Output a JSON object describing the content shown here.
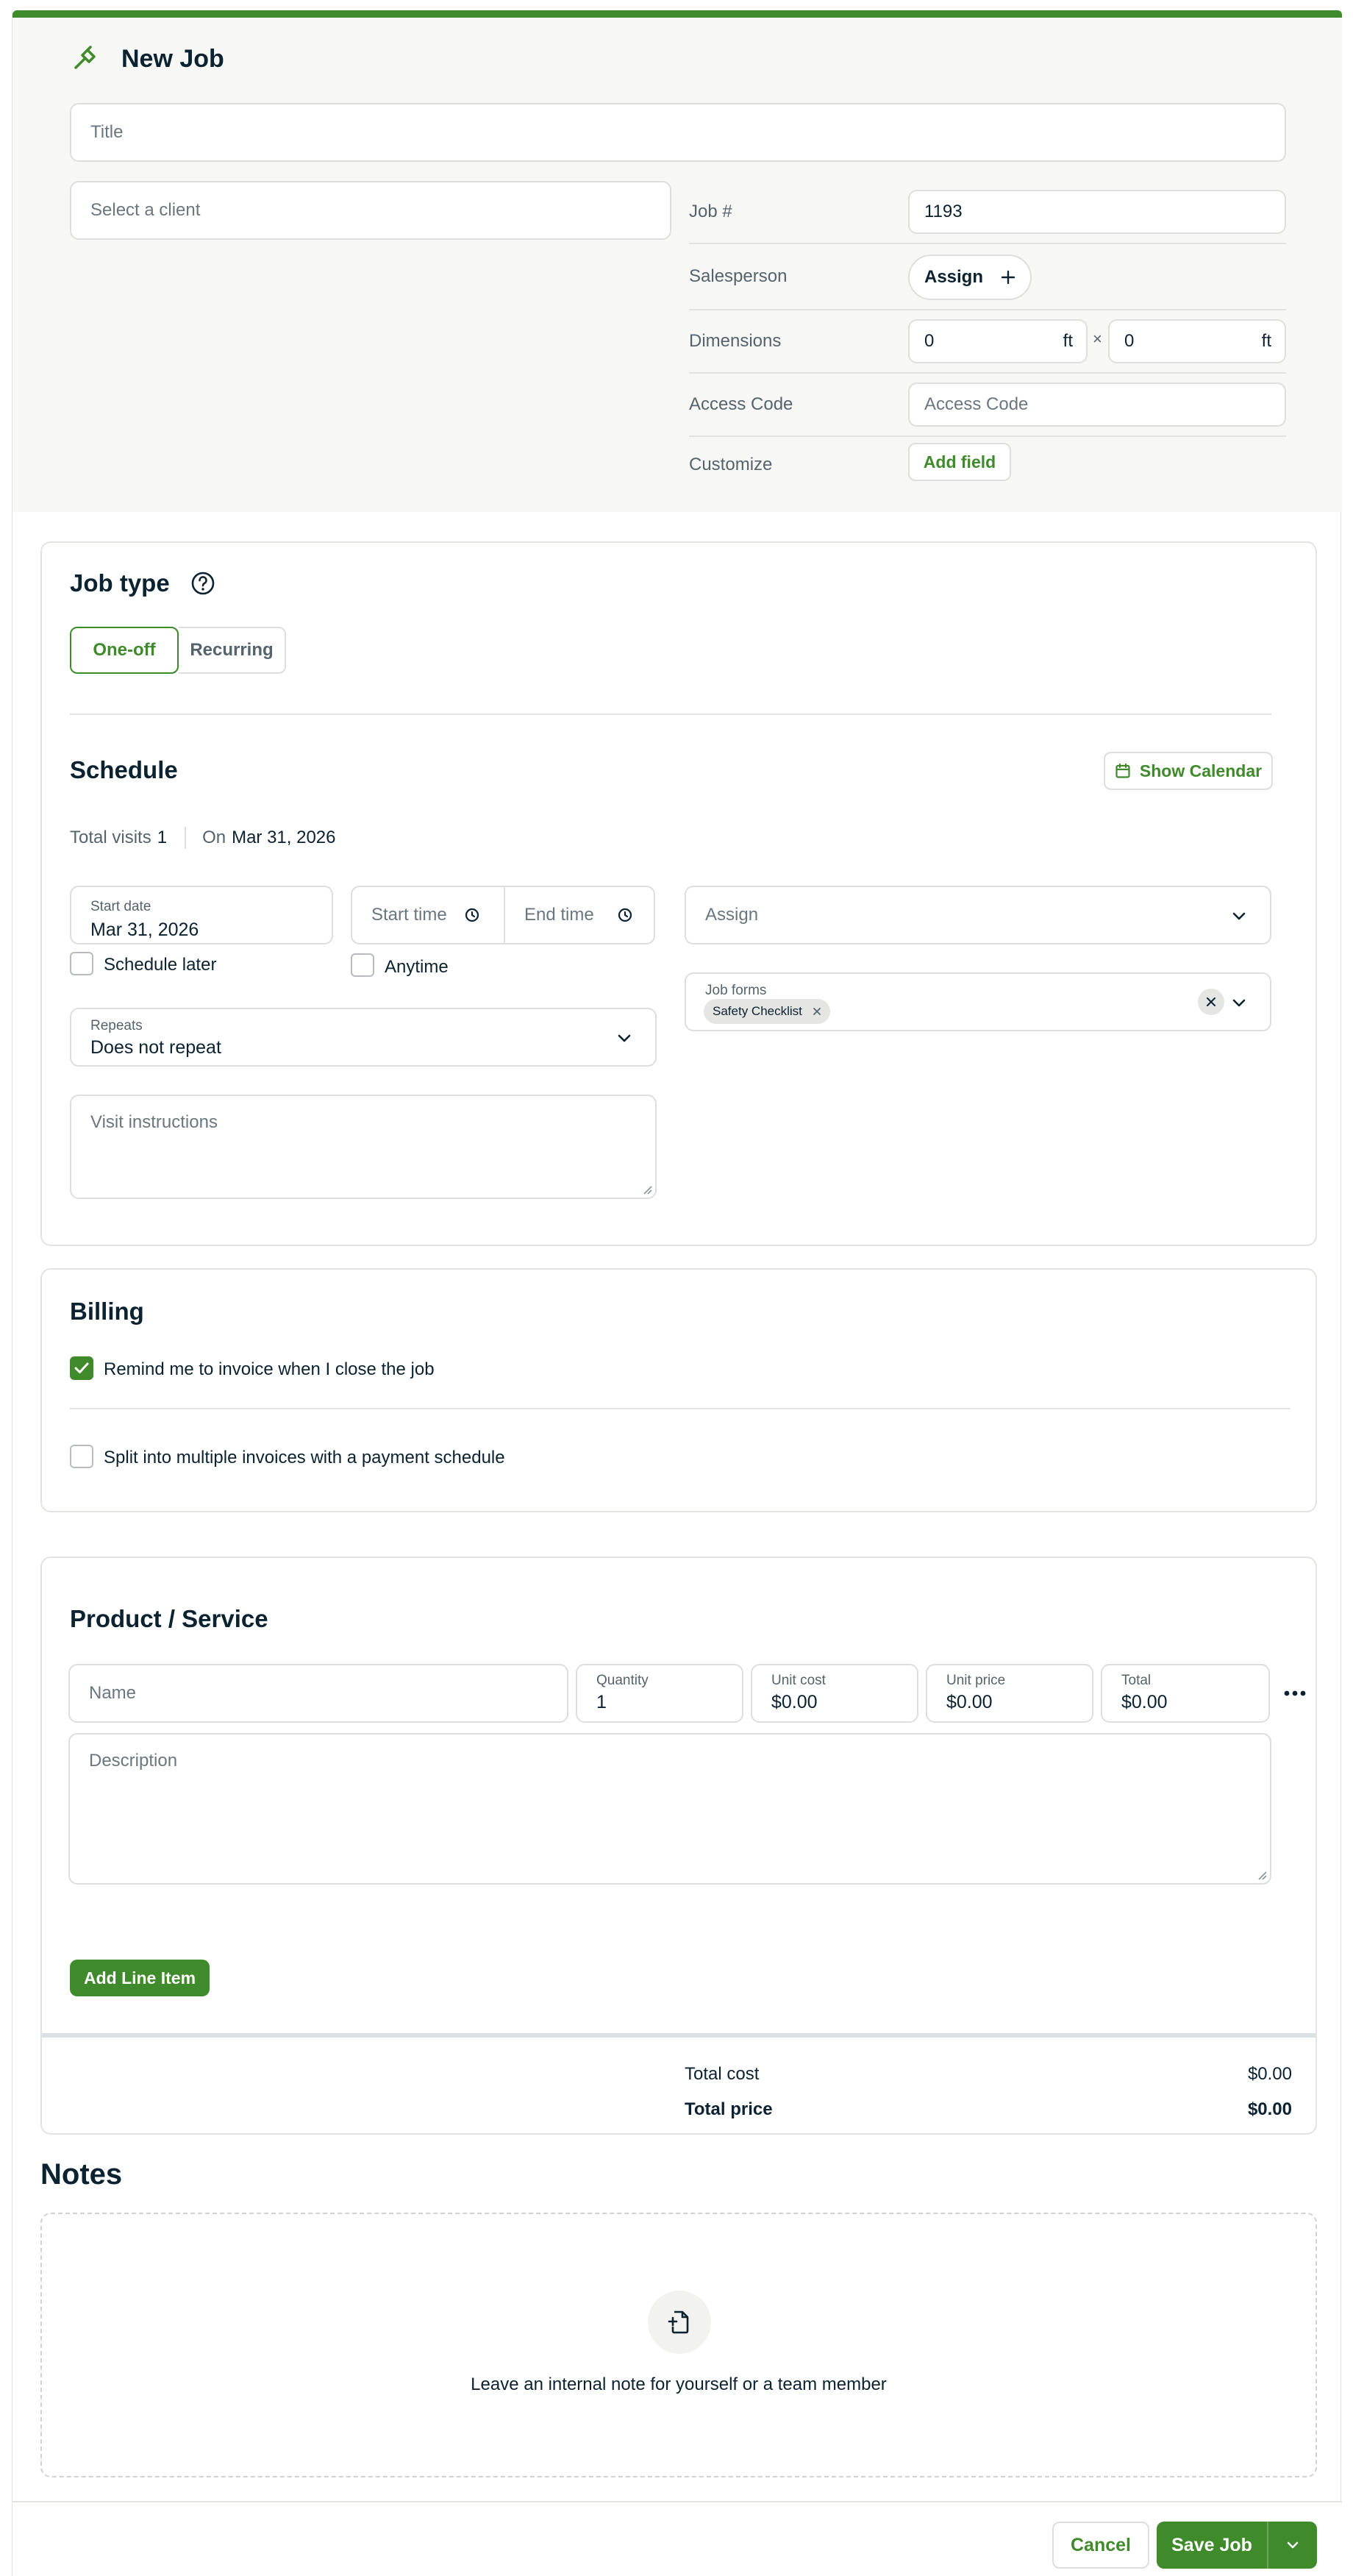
{
  "header": {
    "title": "New Job",
    "title_placeholder": "Title",
    "client_placeholder": "Select a client",
    "job_number_label": "Job #",
    "job_number_value": "1193",
    "salesperson_label": "Salesperson",
    "assign_label": "Assign",
    "dimensions_label": "Dimensions",
    "dim_width": "0",
    "dim_height": "0",
    "dim_unit": "ft",
    "dim_times": "×",
    "access_code_label": "Access Code",
    "access_code_placeholder": "Access Code",
    "customize_label": "Customize",
    "add_field_label": "Add field"
  },
  "job_type": {
    "title": "Job type",
    "options": [
      "One-off",
      "Recurring"
    ],
    "selected": "One-off"
  },
  "schedule": {
    "title": "Schedule",
    "show_calendar": "Show Calendar",
    "total_visits_label": "Total visits",
    "total_visits_value": "1",
    "on_label": "On",
    "on_value": "Mar 31, 2026",
    "start_date_label": "Start date",
    "start_date_value": "Mar 31, 2026",
    "start_time_placeholder": "Start time",
    "end_time_placeholder": "End time",
    "schedule_later": "Schedule later",
    "anytime": "Anytime",
    "repeats_label": "Repeats",
    "repeats_value": "Does not repeat",
    "assign_placeholder": "Assign",
    "job_forms_label": "Job forms",
    "job_forms_chip": "Safety Checklist",
    "visit_instructions_placeholder": "Visit instructions"
  },
  "billing": {
    "title": "Billing",
    "remind_label": "Remind me to invoice when I close the job",
    "remind_checked": true,
    "split_label": "Split into multiple invoices with a payment schedule",
    "split_checked": false
  },
  "product_service": {
    "title": "Product / Service",
    "name_placeholder": "Name",
    "quantity_label": "Quantity",
    "quantity_value": "1",
    "unit_cost_label": "Unit cost",
    "unit_cost_value": "$0.00",
    "unit_price_label": "Unit price",
    "unit_price_value": "$0.00",
    "total_label": "Total",
    "total_value": "$0.00",
    "description_placeholder": "Description",
    "add_line_item": "Add Line Item",
    "total_cost_label": "Total cost",
    "total_cost_value": "$0.00",
    "total_price_label": "Total price",
    "total_price_value": "$0.00"
  },
  "notes": {
    "title": "Notes",
    "empty_text": "Leave an internal note for yourself or a team member"
  },
  "footer": {
    "cancel": "Cancel",
    "save": "Save Job"
  },
  "colors": {
    "accent": "#3f8a2a",
    "text": "#0b2230",
    "header_bg": "#f7f7f5"
  }
}
